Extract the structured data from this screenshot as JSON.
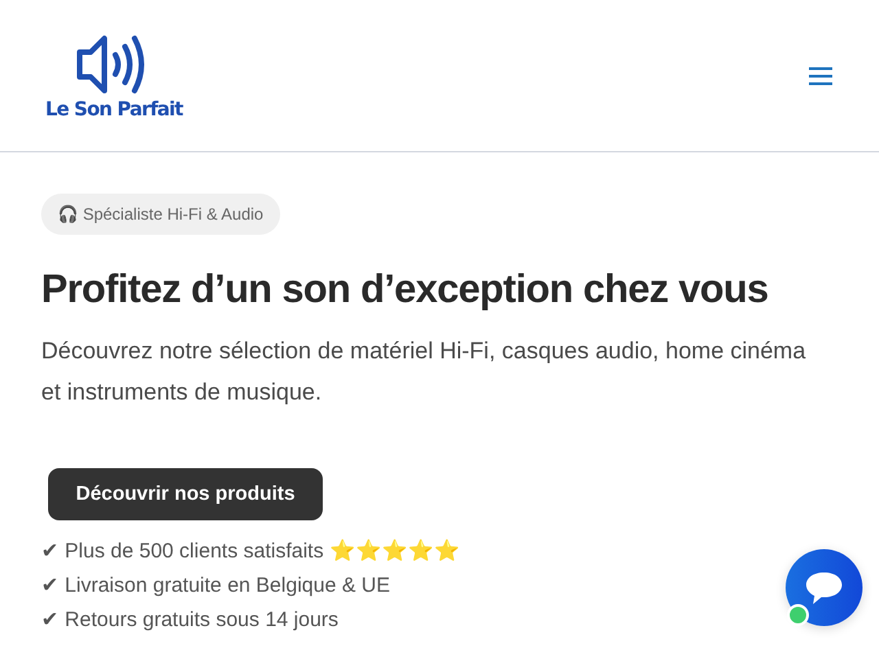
{
  "header": {
    "logo_text": "Le Son Parfait"
  },
  "hero": {
    "badge": "🎧 Spécialiste Hi-Fi & Audio",
    "title": "Profitez d’un son d’exception chez vous",
    "lead": "Découvrez notre sélection de matériel Hi-Fi, casques audio, home cinéma et instruments de musique.",
    "cta": "Découvrir nos produits",
    "benefits": [
      "✔ Plus de 500 clients satisfaits ⭐⭐⭐⭐⭐",
      "✔ Livraison gratuite en Belgique & UE",
      "✔ Retours gratuits sous 14 jours"
    ]
  },
  "chat": {
    "online": true
  }
}
